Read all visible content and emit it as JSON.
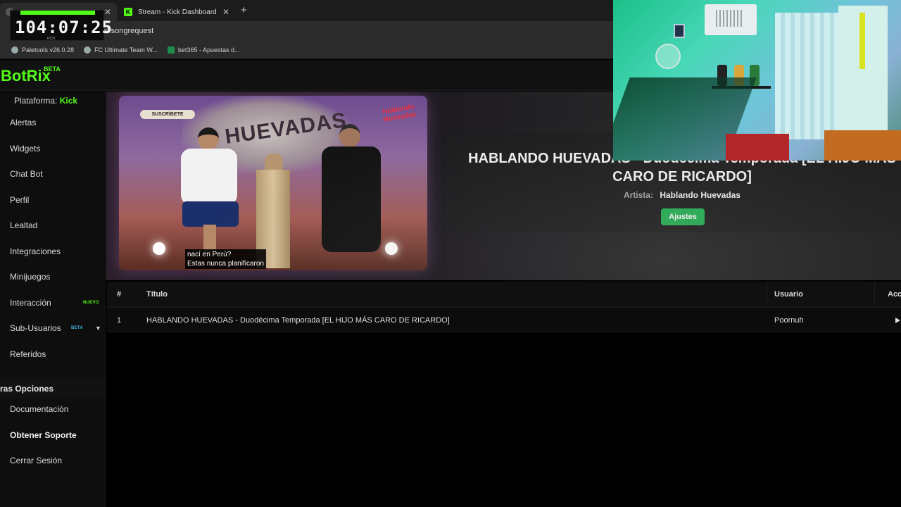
{
  "browser": {
    "tabs": [
      {
        "label": "",
        "active": true
      },
      {
        "label": "Stream - Kick Dashboard",
        "active": false
      }
    ],
    "url_suffix": "el/songrequest",
    "bookmarks": [
      {
        "label": "Paletools v26.0.28",
        "icon": "paletools-icon"
      },
      {
        "label": "FC Ultimate Team W...",
        "icon": "ea-icon"
      },
      {
        "label": "bet365 - Apuestas d...",
        "icon": "bet365-icon"
      }
    ]
  },
  "timer": {
    "value": "104:07:25",
    "tag": "KICK"
  },
  "app": {
    "brand": "BotRix",
    "brand_badge": "BETA",
    "accent_color": "#53fc18"
  },
  "sidebar": {
    "platform_label": "Plataforma:",
    "platform_value": "Kick",
    "items": [
      {
        "label": "Alertas"
      },
      {
        "label": "Widgets"
      },
      {
        "label": "Chat Bot"
      },
      {
        "label": "Perfil"
      },
      {
        "label": "Lealtad"
      },
      {
        "label": "Integraciones"
      },
      {
        "label": "Minijuegos"
      },
      {
        "label": "Interacción",
        "badge": "NUEVO"
      },
      {
        "label": "Sub-Usuarios",
        "badge": "BETA"
      },
      {
        "label": "Referidos"
      }
    ],
    "section_title": "ras Opciones",
    "extra_items": [
      {
        "label": "Documentación"
      },
      {
        "label": "Obtener Soporte"
      },
      {
        "label": "Cerrar Sesión"
      }
    ]
  },
  "now_playing": {
    "title": "HABLANDO HUEVADAS - Duodécima Temporada [EL HIJO MÁS CARO DE RICARDO]",
    "artist_label": "Artista:",
    "artist_value": "Hablando Huevadas",
    "settings_label": "Ajustes",
    "video": {
      "wall_text": "HUEVADAS",
      "subscribe_badge": "SUSCRÍBETE",
      "logo_text": "Hablando Huevadas",
      "caption_line1": "nací en Perú?",
      "caption_line2": "Estas nunca planificaron"
    }
  },
  "queue": {
    "columns": [
      "#",
      "Título",
      "Usuario",
      "Acc"
    ],
    "rows": [
      {
        "num": "1",
        "title": "HABLANDO HUEVADAS - Duodécima Temporada [EL HIJO MÁS CARO DE RICARDO]",
        "user": "Poornuh"
      }
    ]
  }
}
